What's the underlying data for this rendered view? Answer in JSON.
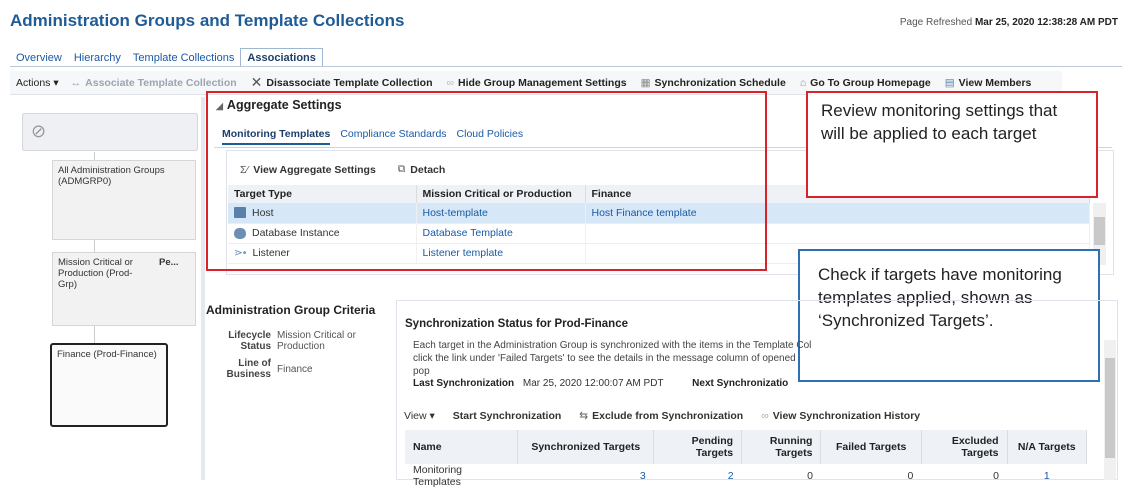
{
  "header": {
    "title": "Administration Groups and Template Collections",
    "refresh_label": "Page Refreshed",
    "refresh_time": "Mar 25, 2020 12:38:28 AM PDT"
  },
  "tabs": [
    "Overview",
    "Hierarchy",
    "Template Collections",
    "Associations"
  ],
  "toolbar": {
    "actions": "Actions",
    "associate": "Associate Template Collection",
    "disassociate": "Disassociate Template Collection",
    "hide_group": "Hide Group Management Settings",
    "sync_schedule": "Synchronization Schedule",
    "go_home": "Go To Group Homepage",
    "view_members": "View Members"
  },
  "hierarchy": {
    "nodes": [
      "All Administration Groups (ADMGRP0)",
      "Mission Critical or Production (Prod-Grp)",
      "Pe...",
      "Finance (Prod-Finance)"
    ]
  },
  "aggregate": {
    "heading": "Aggregate Settings",
    "subtabs": [
      "Monitoring Templates",
      "Compliance Standards",
      "Cloud Policies"
    ],
    "view_settings": "View Aggregate Settings",
    "detach": "Detach",
    "columns": [
      "Target Type",
      "Mission Critical or Production",
      "Finance"
    ],
    "rows": [
      {
        "type": "Host",
        "mcp": "Host-template",
        "fin": "Host Finance template"
      },
      {
        "type": "Database Instance",
        "mcp": "Database Template",
        "fin": ""
      },
      {
        "type": "Listener",
        "mcp": "Listener template",
        "fin": ""
      }
    ]
  },
  "callouts": {
    "review": "Review monitoring settings that will be applied to each target",
    "check": "Check if targets have monitoring templates applied, shown as ‘Synchronized Targets’."
  },
  "criteria": {
    "heading": "Administration Group Criteria",
    "lifecycle_label": "Lifecycle Status",
    "lifecycle_value": "Mission Critical or Production",
    "lob_label": "Line of Business",
    "lob_value": "Finance"
  },
  "sync": {
    "heading": "Synchronization Status for Prod-Finance",
    "desc": "Each target in the Administration Group is synchronized with the items in the Template Col click the link under 'Failed Targets' to see the details in the message column of opened pop",
    "last_label": "Last Synchronization",
    "last_value": "Mar 25, 2020 12:00:07 AM PDT",
    "next_label": "Next Synchronizatio",
    "view": "View",
    "start": "Start Synchronization",
    "exclude": "Exclude from Synchronization",
    "history": "View Synchronization History",
    "columns": [
      "Name",
      "Synchronized Targets",
      "Pending Targets",
      "Running Targets",
      "Failed Targets",
      "Excluded Targets",
      "N/A Targets"
    ],
    "row": {
      "name": "Monitoring Templates",
      "synced": "3",
      "pending": "2",
      "running": "0",
      "failed": "0",
      "excluded": "0",
      "na": "1"
    }
  },
  "colors": {
    "accent": "#1f5b97",
    "callout_red": "#d9232b",
    "callout_blue": "#2f6fb3",
    "selected_row": "#d6e7f7"
  }
}
